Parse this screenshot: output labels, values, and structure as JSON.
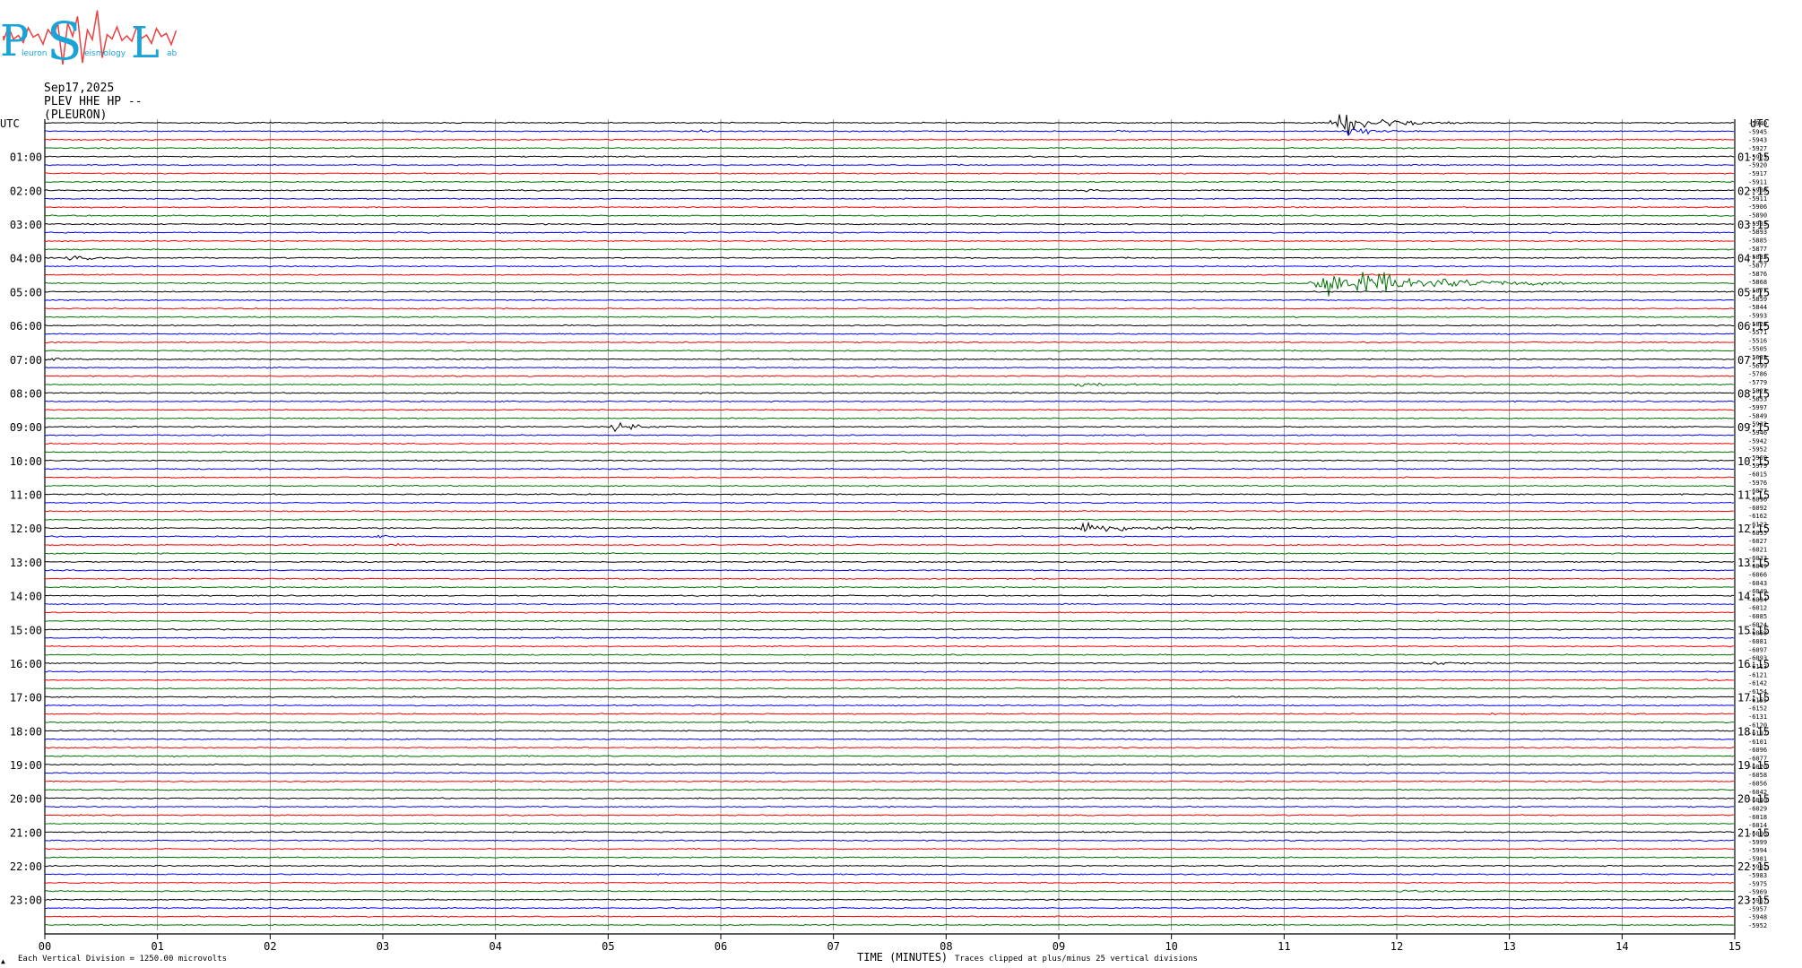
{
  "logo": {
    "letters": [
      "P",
      "S",
      "L"
    ],
    "small_words": [
      "leuron",
      "eismology",
      "ab"
    ],
    "colors": {
      "letters": "#1aa3d6",
      "zigzag": "#ef3f3f"
    }
  },
  "header": {
    "date": "Sep17,2025",
    "station": "PLEV HHE HP --",
    "location": "(PLEURON)"
  },
  "footer": {
    "scale_note": "Each Vertical Division = 1250.00 microvolts",
    "xlabel": "TIME (MINUTES)",
    "clip_note": "Traces clipped at plus/minus 25 vertical divisions",
    "corner_mark": "▲"
  },
  "colors": {
    "trace_cycle": [
      "#000000",
      "#0000ff",
      "#ff0000",
      "#007000"
    ],
    "gridline": "#7a7a7a",
    "frame": "#000000"
  },
  "chart_data": {
    "type": "helicorder",
    "xlim": [
      0,
      15
    ],
    "x_ticks": [
      "00",
      "01",
      "02",
      "03",
      "04",
      "05",
      "06",
      "07",
      "08",
      "09",
      "10",
      "11",
      "12",
      "13",
      "14",
      "15"
    ],
    "row_minutes": 15,
    "rows_count": 96,
    "left_unit": "UTC",
    "right_unit": "UTC",
    "left_labels": [
      "01:00",
      "02:00",
      "03:00",
      "04:00",
      "05:00",
      "06:00",
      "07:00",
      "08:00",
      "09:00",
      "10:00",
      "11:00",
      "12:00",
      "13:00",
      "14:00",
      "15:00",
      "16:00",
      "17:00",
      "18:00",
      "19:00",
      "20:00",
      "21:00",
      "22:00",
      "23:00"
    ],
    "right_labels": [
      "01:15",
      "02:15",
      "03:15",
      "04:15",
      "05:15",
      "06:15",
      "07:15",
      "08:15",
      "09:15",
      "10:15",
      "11:15",
      "12:15",
      "13:15",
      "14:15",
      "15:15",
      "16:15",
      "17:15",
      "18:15",
      "19:15",
      "20:15",
      "21:15",
      "22:15",
      "23:15"
    ],
    "offsets": [
      "-5949",
      "-5945",
      "-5943",
      "-5927",
      "-5923",
      "-5920",
      "-5917",
      "-5911",
      "-5908",
      "-5911",
      "-5906",
      "-5890",
      "-5903",
      "-5893",
      "-5885",
      "-5877",
      "-5882",
      "-5877",
      "-5876",
      "-5868",
      "-5877",
      "-5859",
      "-5844",
      "-5993",
      "-5828",
      "-5571",
      "-5516",
      "-5505",
      "-5635",
      "-5699",
      "-5786",
      "-5779",
      "-5823",
      "-5853",
      "-5997",
      "-5849",
      "-5932",
      "-5946",
      "-5942",
      "-5952",
      "-5969",
      "-5979",
      "-6015",
      "-5976",
      "-6077",
      "-6096",
      "-6092",
      "-6162",
      "-6122",
      "-6055",
      "-6027",
      "-6021",
      "-6033",
      "-6049",
      "-6066",
      "-6043",
      "-6049",
      "-6034",
      "-6012",
      "-6085",
      "-6024",
      "-6068",
      "-6081",
      "-6097",
      "-6093",
      "-6113",
      "-6121",
      "-6142",
      "-6154",
      "-6155",
      "-6152",
      "-6131",
      "-6120",
      "-6107",
      "-6101",
      "-6096",
      "-6077",
      "-6070",
      "-6058",
      "-6056",
      "-6042",
      "-6040",
      "-6029",
      "-6018",
      "-6014",
      "-6006",
      "-5999",
      "-5994",
      "-5981",
      "-5982",
      "-5983",
      "-5975",
      "-5969",
      "-5957",
      "-5957",
      "-5948",
      "-5952"
    ],
    "events": [
      {
        "row": 0,
        "start_min": 11.4,
        "duration_min": 1.3,
        "amplitude": 2.6
      },
      {
        "row": 1,
        "start_min": 11.5,
        "duration_min": 0.6,
        "amplitude": 1.6
      },
      {
        "row": 1,
        "start_min": 9.5,
        "duration_min": 0.4,
        "amplitude": 0.25
      },
      {
        "row": 1,
        "start_min": 5.8,
        "duration_min": 0.3,
        "amplitude": 0.15
      },
      {
        "row": 8,
        "start_min": 9.2,
        "duration_min": 0.4,
        "amplitude": 0.15
      },
      {
        "row": 16,
        "start_min": 0.15,
        "duration_min": 1.0,
        "amplitude": 0.35
      },
      {
        "row": 19,
        "start_min": 11.2,
        "duration_min": 2.8,
        "amplitude": 3.5
      },
      {
        "row": 28,
        "start_min": 0.0,
        "duration_min": 0.4,
        "amplitude": 0.2
      },
      {
        "row": 31,
        "start_min": 9.1,
        "duration_min": 1.0,
        "amplitude": 0.45
      },
      {
        "row": 36,
        "start_min": 5.0,
        "duration_min": 0.9,
        "amplitude": 0.8
      },
      {
        "row": 39,
        "start_min": 7.6,
        "duration_min": 0.3,
        "amplitude": 0.15
      },
      {
        "row": 42,
        "start_min": 2.6,
        "duration_min": 0.3,
        "amplitude": 0.15
      },
      {
        "row": 48,
        "start_min": 9.1,
        "duration_min": 1.5,
        "amplitude": 1.4
      },
      {
        "row": 48,
        "start_min": 4.4,
        "duration_min": 0.1,
        "amplitude": 0.35
      },
      {
        "row": 49,
        "start_min": 2.8,
        "duration_min": 0.7,
        "amplitude": 0.45
      },
      {
        "row": 50,
        "start_min": 3.1,
        "duration_min": 0.3,
        "amplitude": 0.2
      },
      {
        "row": 64,
        "start_min": 12.2,
        "duration_min": 1.0,
        "amplitude": 0.45
      },
      {
        "row": 66,
        "start_min": 14.7,
        "duration_min": 0.3,
        "amplitude": 0.15
      },
      {
        "row": 70,
        "start_min": 12.8,
        "duration_min": 0.3,
        "amplitude": 0.2
      },
      {
        "row": 71,
        "start_min": 6.2,
        "duration_min": 0.4,
        "amplitude": 0.2
      },
      {
        "row": 75,
        "start_min": 1.1,
        "duration_min": 0.3,
        "amplitude": 0.2
      },
      {
        "row": 91,
        "start_min": 12.0,
        "duration_min": 0.6,
        "amplitude": 0.25
      },
      {
        "row": 92,
        "start_min": 14.4,
        "duration_min": 0.4,
        "amplitude": 0.15
      }
    ]
  }
}
